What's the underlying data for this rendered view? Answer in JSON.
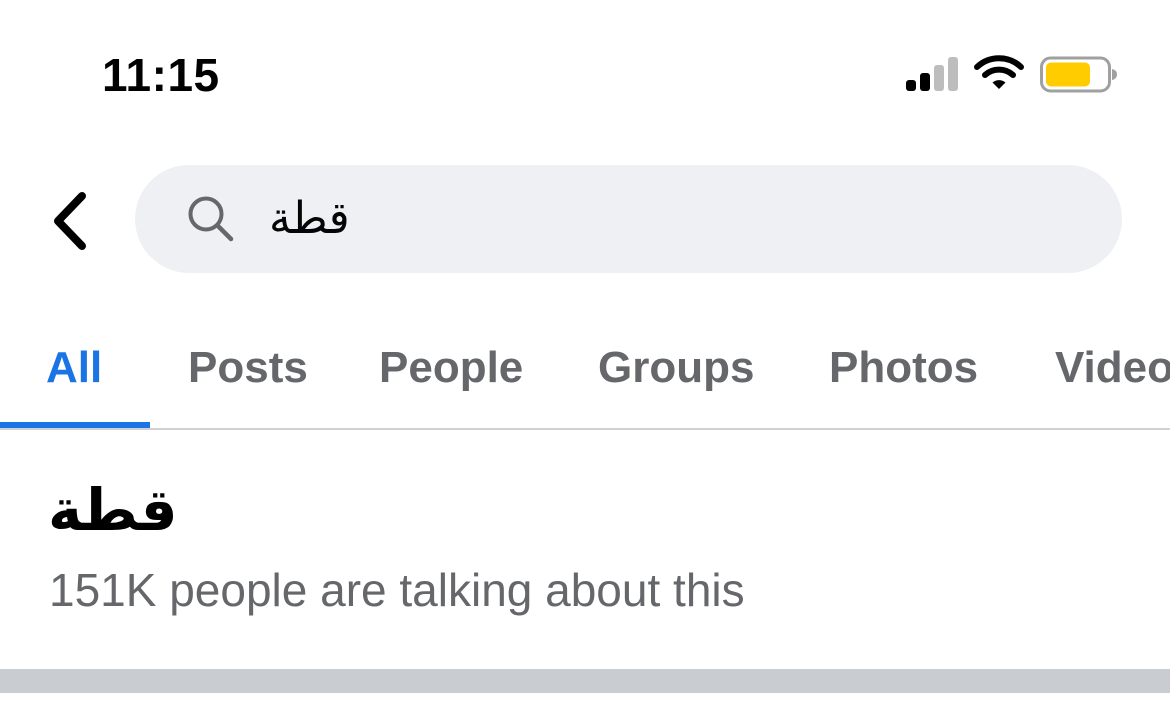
{
  "status_bar": {
    "time": "11:15",
    "signal_icon": "cellular-signal-icon",
    "wifi_icon": "wifi-icon",
    "battery_icon": "battery-icon",
    "battery_color": "#ffcc00"
  },
  "header": {
    "back_icon": "chevron-left-icon",
    "search": {
      "icon": "search-icon",
      "value": "قطة"
    }
  },
  "tabs": {
    "items": [
      {
        "label": "All",
        "active": true
      },
      {
        "label": "Posts",
        "active": false
      },
      {
        "label": "People",
        "active": false
      },
      {
        "label": "Groups",
        "active": false
      },
      {
        "label": "Photos",
        "active": false
      },
      {
        "label": "Videos",
        "active": false
      }
    ],
    "active_color": "#1b74e4",
    "inactive_color": "#65676b"
  },
  "result": {
    "title": "قطة",
    "subtitle": "151K people are talking about this"
  }
}
